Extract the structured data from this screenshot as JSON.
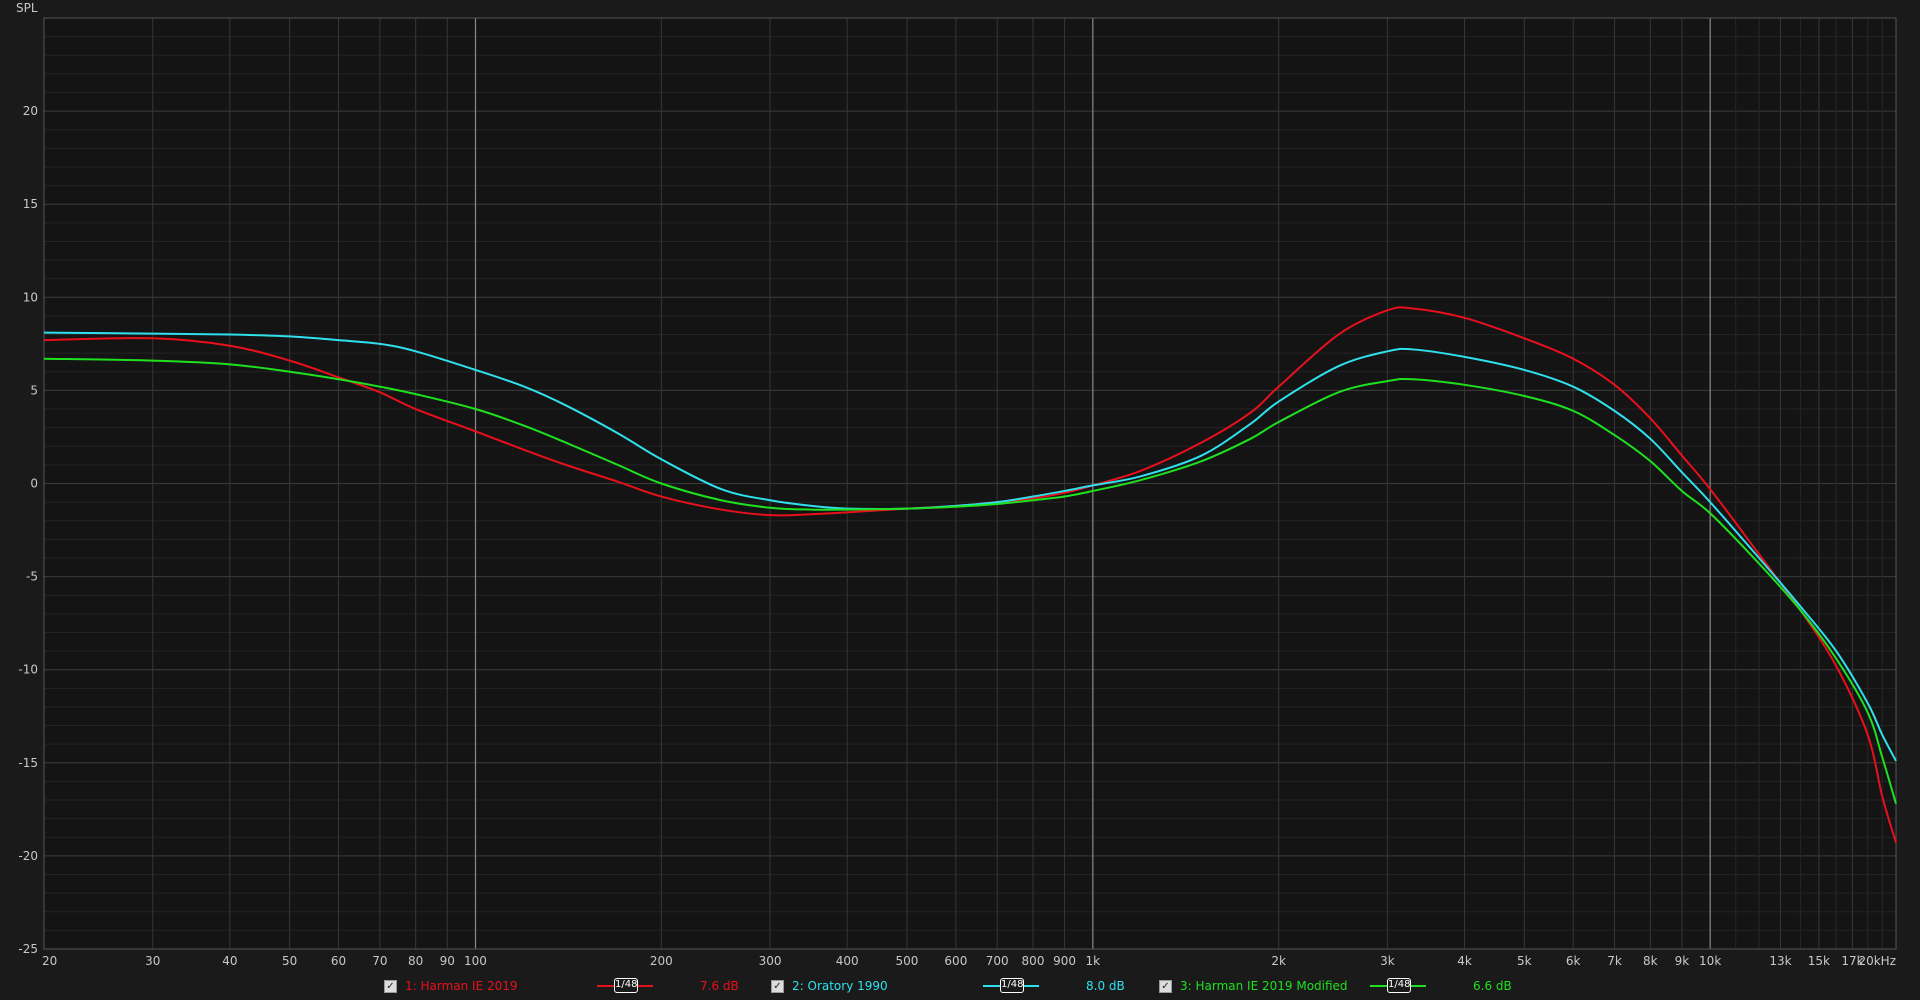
{
  "chart_data": {
    "type": "line",
    "ylabel": "SPL",
    "xscale": "log",
    "xlim": [
      20,
      20000
    ],
    "ylim": [
      -25,
      25
    ],
    "grid": true,
    "y_ticks": [
      20,
      15,
      10,
      5,
      0,
      -5,
      -10,
      -15,
      -20,
      -25
    ],
    "y_tick_labels": [
      "20",
      "15",
      "10",
      "5",
      "0",
      "-5",
      "-10",
      "-15",
      "-20",
      "-25"
    ],
    "x_ticks": [
      20,
      30,
      40,
      50,
      60,
      70,
      80,
      90,
      100,
      200,
      300,
      400,
      500,
      600,
      700,
      800,
      900,
      1000,
      2000,
      3000,
      4000,
      5000,
      6000,
      7000,
      8000,
      9000,
      10000,
      13000,
      15000,
      17000,
      20000
    ],
    "x_tick_labels": [
      "20",
      "30",
      "40",
      "50",
      "60",
      "70",
      "80",
      "90",
      "100",
      "200",
      "300",
      "400",
      "500",
      "600",
      "700",
      "800",
      "900",
      "1k",
      "2k",
      "3k",
      "4k",
      "5k",
      "6k",
      "7k",
      "8k",
      "9k",
      "10k",
      "13k",
      "15k",
      "17k",
      "20kHz"
    ],
    "major_x": [
      100,
      1000,
      10000
    ],
    "series": [
      {
        "name": "1: Harman IE 2019",
        "color": "#e8101c",
        "smoothing": "1/48",
        "offset_label": "7.6 dB",
        "points": [
          [
            20,
            7.7
          ],
          [
            30,
            7.8
          ],
          [
            40,
            7.4
          ],
          [
            50,
            6.6
          ],
          [
            60,
            5.7
          ],
          [
            70,
            4.9
          ],
          [
            80,
            4.0
          ],
          [
            100,
            2.8
          ],
          [
            120,
            1.8
          ],
          [
            140,
            1.0
          ],
          [
            170,
            0.1
          ],
          [
            200,
            -0.7
          ],
          [
            250,
            -1.4
          ],
          [
            300,
            -1.7
          ],
          [
            350,
            -1.65
          ],
          [
            400,
            -1.55
          ],
          [
            500,
            -1.35
          ],
          [
            600,
            -1.2
          ],
          [
            700,
            -1.0
          ],
          [
            800,
            -0.8
          ],
          [
            900,
            -0.5
          ],
          [
            1000,
            -0.1
          ],
          [
            1200,
            0.7
          ],
          [
            1500,
            2.2
          ],
          [
            1800,
            3.8
          ],
          [
            2000,
            5.2
          ],
          [
            2500,
            8.0
          ],
          [
            3000,
            9.3
          ],
          [
            3300,
            9.4
          ],
          [
            4000,
            8.9
          ],
          [
            5000,
            7.8
          ],
          [
            6000,
            6.7
          ],
          [
            7000,
            5.3
          ],
          [
            8000,
            3.5
          ],
          [
            9000,
            1.5
          ],
          [
            10000,
            -0.3
          ],
          [
            12000,
            -3.8
          ],
          [
            14000,
            -6.8
          ],
          [
            16000,
            -9.8
          ],
          [
            18000,
            -13.5
          ],
          [
            19000,
            -16.8
          ],
          [
            20000,
            -19.3
          ]
        ]
      },
      {
        "name": "2: Oratory 1990",
        "color": "#2fe0ec",
        "smoothing": "1/48",
        "offset_label": "8.0 dB",
        "points": [
          [
            20,
            8.1
          ],
          [
            30,
            8.05
          ],
          [
            40,
            8.0
          ],
          [
            50,
            7.9
          ],
          [
            60,
            7.7
          ],
          [
            70,
            7.5
          ],
          [
            80,
            7.1
          ],
          [
            100,
            6.1
          ],
          [
            120,
            5.2
          ],
          [
            140,
            4.2
          ],
          [
            170,
            2.7
          ],
          [
            200,
            1.3
          ],
          [
            250,
            -0.3
          ],
          [
            300,
            -0.9
          ],
          [
            350,
            -1.2
          ],
          [
            400,
            -1.35
          ],
          [
            500,
            -1.35
          ],
          [
            600,
            -1.2
          ],
          [
            700,
            -1.0
          ],
          [
            800,
            -0.7
          ],
          [
            900,
            -0.4
          ],
          [
            1000,
            -0.1
          ],
          [
            1200,
            0.4
          ],
          [
            1500,
            1.5
          ],
          [
            1800,
            3.2
          ],
          [
            2000,
            4.4
          ],
          [
            2500,
            6.3
          ],
          [
            3000,
            7.1
          ],
          [
            3300,
            7.2
          ],
          [
            4000,
            6.8
          ],
          [
            5000,
            6.1
          ],
          [
            6000,
            5.2
          ],
          [
            7000,
            3.9
          ],
          [
            8000,
            2.4
          ],
          [
            9000,
            0.6
          ],
          [
            10000,
            -1.0
          ],
          [
            12000,
            -4.0
          ],
          [
            14000,
            -6.6
          ],
          [
            16000,
            -9.0
          ],
          [
            18000,
            -11.8
          ],
          [
            19000,
            -13.5
          ],
          [
            20000,
            -14.9
          ]
        ]
      },
      {
        "name": "3: Harman IE 2019 Modified",
        "color": "#1fe01f",
        "smoothing": "1/48",
        "offset_label": "6.6 dB",
        "points": [
          [
            20,
            6.7
          ],
          [
            30,
            6.6
          ],
          [
            40,
            6.4
          ],
          [
            50,
            6.0
          ],
          [
            60,
            5.6
          ],
          [
            70,
            5.2
          ],
          [
            80,
            4.8
          ],
          [
            100,
            4.0
          ],
          [
            120,
            3.1
          ],
          [
            140,
            2.2
          ],
          [
            170,
            1.0
          ],
          [
            200,
            0.0
          ],
          [
            250,
            -0.9
          ],
          [
            300,
            -1.3
          ],
          [
            350,
            -1.4
          ],
          [
            400,
            -1.4
          ],
          [
            500,
            -1.35
          ],
          [
            600,
            -1.25
          ],
          [
            700,
            -1.1
          ],
          [
            800,
            -0.9
          ],
          [
            900,
            -0.7
          ],
          [
            1000,
            -0.4
          ],
          [
            1200,
            0.2
          ],
          [
            1500,
            1.2
          ],
          [
            1800,
            2.4
          ],
          [
            2000,
            3.3
          ],
          [
            2500,
            4.9
          ],
          [
            3000,
            5.5
          ],
          [
            3300,
            5.6
          ],
          [
            4000,
            5.3
          ],
          [
            5000,
            4.7
          ],
          [
            6000,
            3.9
          ],
          [
            7000,
            2.6
          ],
          [
            8000,
            1.2
          ],
          [
            9000,
            -0.4
          ],
          [
            10000,
            -1.6
          ],
          [
            12000,
            -4.3
          ],
          [
            14000,
            -6.8
          ],
          [
            16000,
            -9.4
          ],
          [
            18000,
            -12.3
          ],
          [
            19000,
            -14.7
          ],
          [
            20000,
            -17.2
          ]
        ]
      }
    ]
  }
}
